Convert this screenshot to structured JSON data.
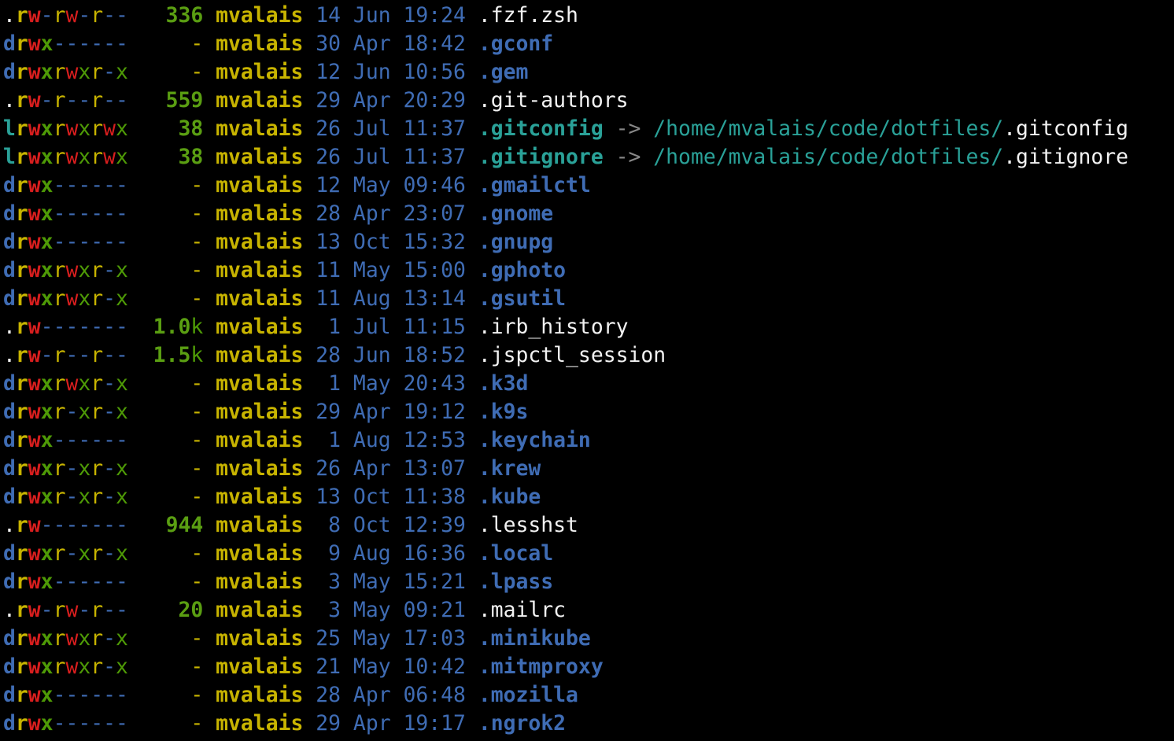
{
  "colors": {
    "perm_type_dir": "#3f6cb4",
    "perm_type_link": "#2aa198",
    "perm_type_file": "#f2f2f2",
    "perm_read": "#c8b400",
    "perm_write": "#d81e1e",
    "perm_exec": "#4e9a06",
    "perm_dash": "#3f6cb4",
    "size": "#5a9e12",
    "size_unit": "#4e9a06",
    "size_dash": "#c8b400",
    "user": "#c8b400",
    "date": "#3f6cb4",
    "name_dir": "#3f6cb4",
    "name_link": "#2aa198",
    "name_file": "#f2f2f2",
    "arrow": "#888888",
    "link_target_path": "#2aa198",
    "link_target_file": "#f2f2f2"
  },
  "entries": [
    {
      "perms": ".rw-rw-r--",
      "size": "336",
      "user": "mvalais",
      "date": "14 Jun 19:24",
      "name": ".fzf.zsh",
      "kind": "file"
    },
    {
      "perms": "drwx------",
      "size": "-",
      "user": "mvalais",
      "date": "30 Apr 18:42",
      "name": ".gconf",
      "kind": "dir"
    },
    {
      "perms": "drwxrwxr-x",
      "size": "-",
      "user": "mvalais",
      "date": "12 Jun 10:56",
      "name": ".gem",
      "kind": "dir"
    },
    {
      "perms": ".rw-r--r--",
      "size": "559",
      "user": "mvalais",
      "date": "29 Apr 20:29",
      "name": ".git-authors",
      "kind": "file"
    },
    {
      "perms": "lrwxrwxrwx",
      "size": "38",
      "user": "mvalais",
      "date": "26 Jul 11:37",
      "name": ".gitconfig",
      "kind": "link",
      "arrow": "->",
      "target_path": "/home/mvalais/code/dotfiles/",
      "target_file": ".gitconfig"
    },
    {
      "perms": "lrwxrwxrwx",
      "size": "38",
      "user": "mvalais",
      "date": "26 Jul 11:37",
      "name": ".gitignore",
      "kind": "link",
      "arrow": "->",
      "target_path": "/home/mvalais/code/dotfiles/",
      "target_file": ".gitignore"
    },
    {
      "perms": "drwx------",
      "size": "-",
      "user": "mvalais",
      "date": "12 May 09:46",
      "name": ".gmailctl",
      "kind": "dir"
    },
    {
      "perms": "drwx------",
      "size": "-",
      "user": "mvalais",
      "date": "28 Apr 23:07",
      "name": ".gnome",
      "kind": "dir"
    },
    {
      "perms": "drwx------",
      "size": "-",
      "user": "mvalais",
      "date": "13 Oct 15:32",
      "name": ".gnupg",
      "kind": "dir"
    },
    {
      "perms": "drwxrwxr-x",
      "size": "-",
      "user": "mvalais",
      "date": "11 May 15:00",
      "name": ".gphoto",
      "kind": "dir"
    },
    {
      "perms": "drwxrwxr-x",
      "size": "-",
      "user": "mvalais",
      "date": "11 Aug 13:14",
      "name": ".gsutil",
      "kind": "dir"
    },
    {
      "perms": ".rw-------",
      "size": "1.0k",
      "user": "mvalais",
      "date": " 1 Jul 11:15",
      "name": ".irb_history",
      "kind": "file"
    },
    {
      "perms": ".rw-r--r--",
      "size": "1.5k",
      "user": "mvalais",
      "date": "28 Jun 18:52",
      "name": ".jspctl_session",
      "kind": "file"
    },
    {
      "perms": "drwxrwxr-x",
      "size": "-",
      "user": "mvalais",
      "date": " 1 May 20:43",
      "name": ".k3d",
      "kind": "dir"
    },
    {
      "perms": "drwxr-xr-x",
      "size": "-",
      "user": "mvalais",
      "date": "29 Apr 19:12",
      "name": ".k9s",
      "kind": "dir"
    },
    {
      "perms": "drwx------",
      "size": "-",
      "user": "mvalais",
      "date": " 1 Aug 12:53",
      "name": ".keychain",
      "kind": "dir"
    },
    {
      "perms": "drwxr-xr-x",
      "size": "-",
      "user": "mvalais",
      "date": "26 Apr 13:07",
      "name": ".krew",
      "kind": "dir"
    },
    {
      "perms": "drwxr-xr-x",
      "size": "-",
      "user": "mvalais",
      "date": "13 Oct 11:38",
      "name": ".kube",
      "kind": "dir"
    },
    {
      "perms": ".rw-------",
      "size": "944",
      "user": "mvalais",
      "date": " 8 Oct 12:39",
      "name": ".lesshst",
      "kind": "file"
    },
    {
      "perms": "drwxr-xr-x",
      "size": "-",
      "user": "mvalais",
      "date": " 9 Aug 16:36",
      "name": ".local",
      "kind": "dir"
    },
    {
      "perms": "drwx------",
      "size": "-",
      "user": "mvalais",
      "date": " 3 May 15:21",
      "name": ".lpass",
      "kind": "dir"
    },
    {
      "perms": ".rw-rw-r--",
      "size": "20",
      "user": "mvalais",
      "date": " 3 May 09:21",
      "name": ".mailrc",
      "kind": "file"
    },
    {
      "perms": "drwxrwxr-x",
      "size": "-",
      "user": "mvalais",
      "date": "25 May 17:03",
      "name": ".minikube",
      "kind": "dir"
    },
    {
      "perms": "drwxrwxr-x",
      "size": "-",
      "user": "mvalais",
      "date": "21 May 10:42",
      "name": ".mitmproxy",
      "kind": "dir"
    },
    {
      "perms": "drwx------",
      "size": "-",
      "user": "mvalais",
      "date": "28 Apr 06:48",
      "name": ".mozilla",
      "kind": "dir"
    },
    {
      "perms": "drwx------",
      "size": "-",
      "user": "mvalais",
      "date": "29 Apr 19:17",
      "name": ".ngrok2",
      "kind": "dir"
    }
  ]
}
